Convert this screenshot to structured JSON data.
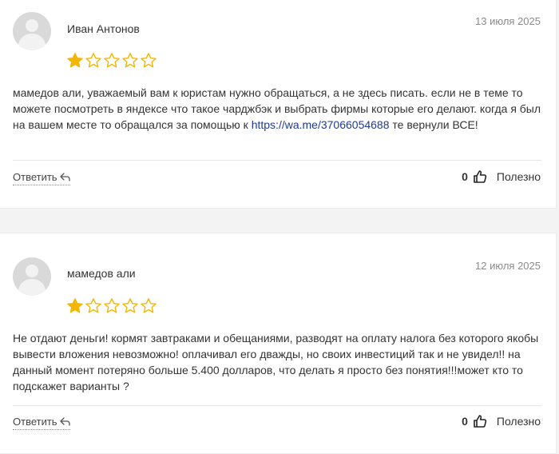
{
  "reviews": [
    {
      "author": "Иван Антонов",
      "date": "13 июля 2025",
      "rating": 1,
      "rating_max": 5,
      "text_before_link": "мамедов али, уважаемый вам к юристам нужно обращаться, а не здесь писать. если не в теме то можете посмотреть в яндексе что такое чарджбэк и выбрать фирмы которые его делают. когда я был на вашем месте то обращался за помощью к ",
      "link": "https://wa.me/37066054688",
      "text_after_link": " те вернули ВСЕ!",
      "reply_label": "Ответить",
      "likes": "0",
      "helpful_label": "Полезно"
    },
    {
      "author": "мамедов али",
      "date": "12 июля 2025",
      "rating": 1,
      "rating_max": 5,
      "text": "Не отдают деньги! кормят завтраками и обещаниями, разводят на оплату налога без которого якобы вывести вложения невозможно! оплачивал его дважды, но своих инвестиций так и не увидел!! на данный момент потеряно больше 5.400 долларов, что делать я просто без понятия!!!может кто то подскажет варианты ?",
      "reply_label": "Ответить",
      "likes": "0",
      "helpful_label": "Полезно"
    }
  ],
  "colors": {
    "star": "#f2b705",
    "link": "#1f3b8f",
    "date": "#8a8a8a"
  }
}
